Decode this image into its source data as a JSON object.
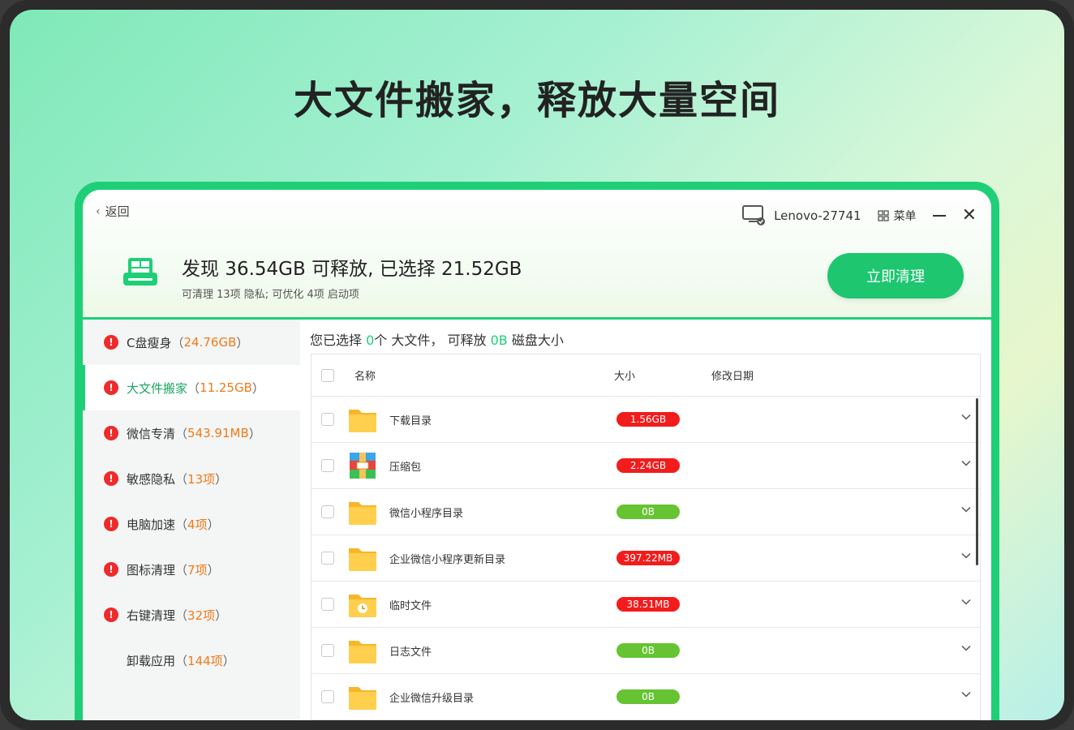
{
  "headline": "大文件搬家，释放大量空间",
  "header": {
    "back_label": "返回",
    "pc_name": "Lenovo-27741",
    "menu_label": "菜单",
    "summary_title": "发现 36.54GB 可释放, 已选择 21.52GB",
    "summary_sub": "可清理 13项 隐私; 可优化 4项 启动项",
    "clean_button": "立即清理"
  },
  "sidebar": {
    "items": [
      {
        "label": "C盘瘦身",
        "size": "24.76GB",
        "warn": true,
        "active": false
      },
      {
        "label": "大文件搬家",
        "size": "11.25GB",
        "warn": true,
        "active": true
      },
      {
        "label": "微信专清",
        "size": "543.91MB",
        "warn": true,
        "active": false
      },
      {
        "label": "敏感隐私",
        "size": "13项",
        "warn": true,
        "active": false
      },
      {
        "label": "电脑加速",
        "size": "4项",
        "warn": true,
        "active": false
      },
      {
        "label": "图标清理",
        "size": "7项",
        "warn": true,
        "active": false
      },
      {
        "label": "右键清理",
        "size": "32项",
        "warn": true,
        "active": false
      },
      {
        "label": "卸载应用",
        "size": "144项",
        "warn": false,
        "active": false
      }
    ]
  },
  "status": {
    "prefix": "您已选择",
    "count": "0",
    "mid": "个 大文件，  可释放",
    "amount": "0B",
    "suffix": "磁盘大小"
  },
  "table": {
    "headers": {
      "name": "名称",
      "size": "大小",
      "date": "修改日期"
    },
    "rows": [
      {
        "name": "下载目录",
        "size": "1.56GB",
        "color": "red",
        "icon": "folder-icon"
      },
      {
        "name": "压缩包",
        "size": "2.24GB",
        "color": "red",
        "icon": "archive-icon"
      },
      {
        "name": "微信小程序目录",
        "size": "0B",
        "color": "green",
        "icon": "folder-icon"
      },
      {
        "name": "企业微信小程序更新目录",
        "size": "397.22MB",
        "color": "red",
        "icon": "folder-icon"
      },
      {
        "name": "临时文件",
        "size": "38.51MB",
        "color": "red",
        "icon": "clock-folder-icon"
      },
      {
        "name": "日志文件",
        "size": "0B",
        "color": "green",
        "icon": "folder-icon"
      },
      {
        "name": "企业微信升级目录",
        "size": "0B",
        "color": "green",
        "icon": "folder-icon"
      }
    ]
  },
  "colors": {
    "accent": "#1fcf77",
    "badge_red": "#f21c1c",
    "badge_green": "#66c332",
    "size_orange": "#f07a18",
    "warn_red": "#ef2a2a"
  }
}
